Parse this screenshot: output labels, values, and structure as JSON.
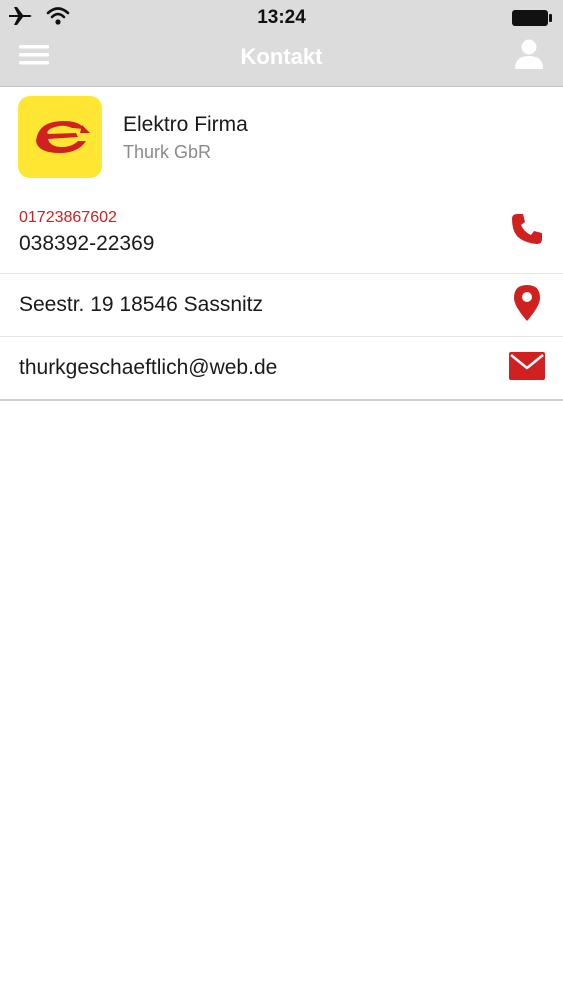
{
  "status_bar": {
    "time": "13:24",
    "icons": [
      "airplane-icon",
      "wifi-icon",
      "battery-icon"
    ]
  },
  "nav": {
    "title": "Kontakt",
    "left_icon": "hamburger-menu-icon",
    "right_icon": "user-icon"
  },
  "company": {
    "name": "Elektro Firma",
    "subtitle": "Thurk GbR",
    "logo_icon": "e-logo-icon"
  },
  "contacts": {
    "phone_mobile": "01723867602",
    "phone_main": "038392-22369",
    "address": "Seestr. 19 18546 Sassnitz",
    "email": "thurkgeschaeftlich@web.de"
  },
  "colors": {
    "accent": "#d0201f",
    "nav_background": "#dcdcdc",
    "logo_background": "#ffe633"
  }
}
